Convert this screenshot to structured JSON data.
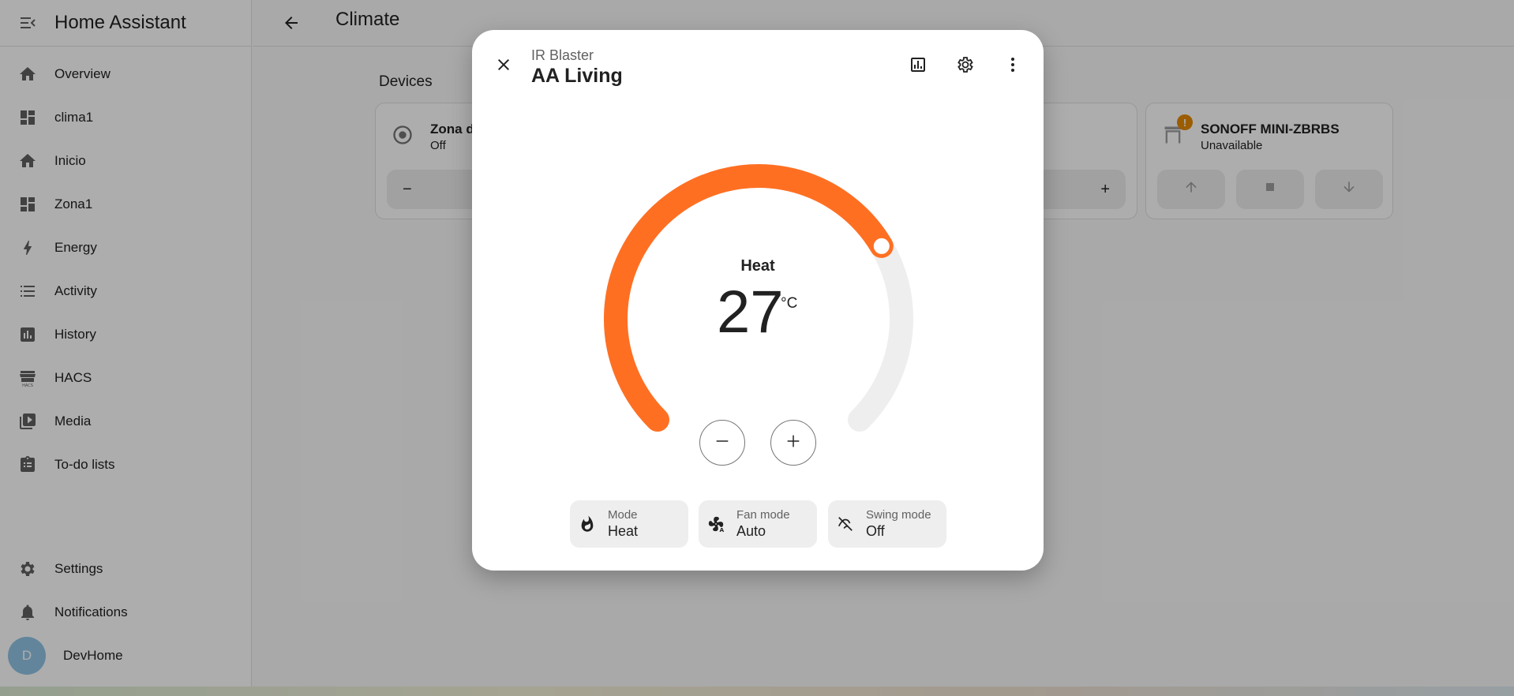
{
  "app": {
    "title": "Home Assistant"
  },
  "sidebar": {
    "items": [
      {
        "label": "Overview",
        "icon": "home-icon"
      },
      {
        "label": "clima1",
        "icon": "dashboard-icon"
      },
      {
        "label": "Inicio",
        "icon": "home-icon"
      },
      {
        "label": "Zona1",
        "icon": "dashboard-icon"
      },
      {
        "label": "Energy",
        "icon": "lightning-icon"
      },
      {
        "label": "Activity",
        "icon": "list-icon"
      },
      {
        "label": "History",
        "icon": "chart-box-icon"
      },
      {
        "label": "HACS",
        "icon": "hacs-icon"
      },
      {
        "label": "Media",
        "icon": "media-icon"
      },
      {
        "label": "To-do lists",
        "icon": "clipboard-list-icon"
      }
    ],
    "settings": "Settings",
    "notifications": "Notifications",
    "user": {
      "initial": "D",
      "name": "DevHome"
    }
  },
  "page": {
    "title": "Climate",
    "section": "Devices"
  },
  "cards": [
    {
      "name": "Zona d",
      "state": "Off",
      "minus": "−"
    },
    {
      "plus": "+"
    },
    {
      "name": "SONOFF MINI-ZBRBS",
      "state": "Unavailable",
      "badge": "!"
    }
  ],
  "dialog": {
    "subtitle": "IR Blaster",
    "title": "AA Living",
    "hvac_mode_label": "Heat",
    "target_temperature": "27",
    "unit": "°C",
    "gauge_fill_fraction": 0.72,
    "chips": [
      {
        "key": "Mode",
        "value": "Heat",
        "icon": "fire-icon"
      },
      {
        "key": "Fan mode",
        "value": "Auto",
        "icon": "fan-auto-icon"
      },
      {
        "key": "Swing mode",
        "value": "Off",
        "icon": "swing-off-icon"
      }
    ]
  },
  "colors": {
    "accent": "#ff6f22",
    "track": "#eeeeee",
    "scrim": "rgba(0,0,0,0.32)",
    "warning": "#e68a00"
  }
}
